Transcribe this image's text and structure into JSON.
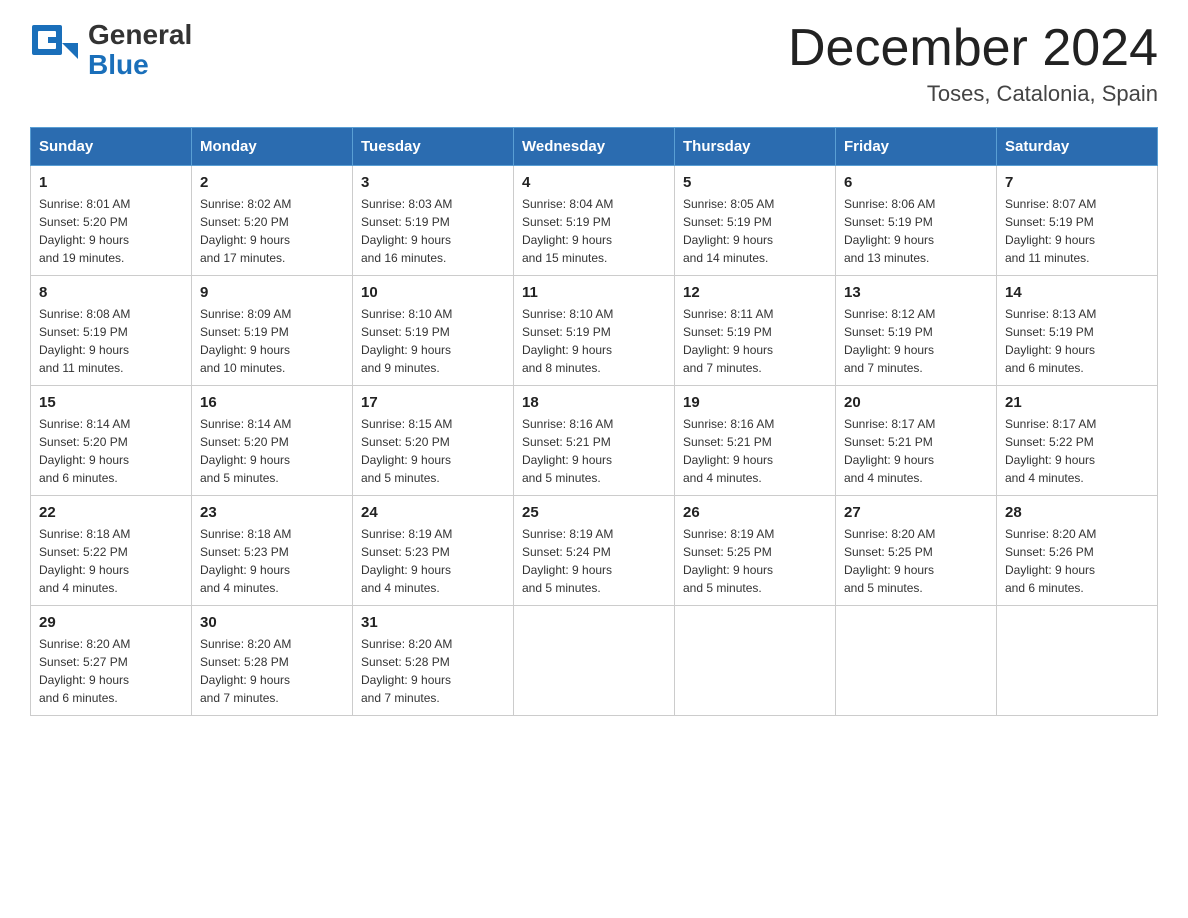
{
  "header": {
    "logo_general": "General",
    "logo_blue": "Blue",
    "month_year": "December 2024",
    "location": "Toses, Catalonia, Spain"
  },
  "days_of_week": [
    "Sunday",
    "Monday",
    "Tuesday",
    "Wednesday",
    "Thursday",
    "Friday",
    "Saturday"
  ],
  "weeks": [
    [
      {
        "day": "1",
        "sunrise": "8:01 AM",
        "sunset": "5:20 PM",
        "daylight": "9 hours and 19 minutes."
      },
      {
        "day": "2",
        "sunrise": "8:02 AM",
        "sunset": "5:20 PM",
        "daylight": "9 hours and 17 minutes."
      },
      {
        "day": "3",
        "sunrise": "8:03 AM",
        "sunset": "5:19 PM",
        "daylight": "9 hours and 16 minutes."
      },
      {
        "day": "4",
        "sunrise": "8:04 AM",
        "sunset": "5:19 PM",
        "daylight": "9 hours and 15 minutes."
      },
      {
        "day": "5",
        "sunrise": "8:05 AM",
        "sunset": "5:19 PM",
        "daylight": "9 hours and 14 minutes."
      },
      {
        "day": "6",
        "sunrise": "8:06 AM",
        "sunset": "5:19 PM",
        "daylight": "9 hours and 13 minutes."
      },
      {
        "day": "7",
        "sunrise": "8:07 AM",
        "sunset": "5:19 PM",
        "daylight": "9 hours and 11 minutes."
      }
    ],
    [
      {
        "day": "8",
        "sunrise": "8:08 AM",
        "sunset": "5:19 PM",
        "daylight": "9 hours and 11 minutes."
      },
      {
        "day": "9",
        "sunrise": "8:09 AM",
        "sunset": "5:19 PM",
        "daylight": "9 hours and 10 minutes."
      },
      {
        "day": "10",
        "sunrise": "8:10 AM",
        "sunset": "5:19 PM",
        "daylight": "9 hours and 9 minutes."
      },
      {
        "day": "11",
        "sunrise": "8:10 AM",
        "sunset": "5:19 PM",
        "daylight": "9 hours and 8 minutes."
      },
      {
        "day": "12",
        "sunrise": "8:11 AM",
        "sunset": "5:19 PM",
        "daylight": "9 hours and 7 minutes."
      },
      {
        "day": "13",
        "sunrise": "8:12 AM",
        "sunset": "5:19 PM",
        "daylight": "9 hours and 7 minutes."
      },
      {
        "day": "14",
        "sunrise": "8:13 AM",
        "sunset": "5:19 PM",
        "daylight": "9 hours and 6 minutes."
      }
    ],
    [
      {
        "day": "15",
        "sunrise": "8:14 AM",
        "sunset": "5:20 PM",
        "daylight": "9 hours and 6 minutes."
      },
      {
        "day": "16",
        "sunrise": "8:14 AM",
        "sunset": "5:20 PM",
        "daylight": "9 hours and 5 minutes."
      },
      {
        "day": "17",
        "sunrise": "8:15 AM",
        "sunset": "5:20 PM",
        "daylight": "9 hours and 5 minutes."
      },
      {
        "day": "18",
        "sunrise": "8:16 AM",
        "sunset": "5:21 PM",
        "daylight": "9 hours and 5 minutes."
      },
      {
        "day": "19",
        "sunrise": "8:16 AM",
        "sunset": "5:21 PM",
        "daylight": "9 hours and 4 minutes."
      },
      {
        "day": "20",
        "sunrise": "8:17 AM",
        "sunset": "5:21 PM",
        "daylight": "9 hours and 4 minutes."
      },
      {
        "day": "21",
        "sunrise": "8:17 AM",
        "sunset": "5:22 PM",
        "daylight": "9 hours and 4 minutes."
      }
    ],
    [
      {
        "day": "22",
        "sunrise": "8:18 AM",
        "sunset": "5:22 PM",
        "daylight": "9 hours and 4 minutes."
      },
      {
        "day": "23",
        "sunrise": "8:18 AM",
        "sunset": "5:23 PM",
        "daylight": "9 hours and 4 minutes."
      },
      {
        "day": "24",
        "sunrise": "8:19 AM",
        "sunset": "5:23 PM",
        "daylight": "9 hours and 4 minutes."
      },
      {
        "day": "25",
        "sunrise": "8:19 AM",
        "sunset": "5:24 PM",
        "daylight": "9 hours and 5 minutes."
      },
      {
        "day": "26",
        "sunrise": "8:19 AM",
        "sunset": "5:25 PM",
        "daylight": "9 hours and 5 minutes."
      },
      {
        "day": "27",
        "sunrise": "8:20 AM",
        "sunset": "5:25 PM",
        "daylight": "9 hours and 5 minutes."
      },
      {
        "day": "28",
        "sunrise": "8:20 AM",
        "sunset": "5:26 PM",
        "daylight": "9 hours and 6 minutes."
      }
    ],
    [
      {
        "day": "29",
        "sunrise": "8:20 AM",
        "sunset": "5:27 PM",
        "daylight": "9 hours and 6 minutes."
      },
      {
        "day": "30",
        "sunrise": "8:20 AM",
        "sunset": "5:28 PM",
        "daylight": "9 hours and 7 minutes."
      },
      {
        "day": "31",
        "sunrise": "8:20 AM",
        "sunset": "5:28 PM",
        "daylight": "9 hours and 7 minutes."
      },
      null,
      null,
      null,
      null
    ]
  ],
  "labels": {
    "sunrise": "Sunrise:",
    "sunset": "Sunset:",
    "daylight": "Daylight:"
  }
}
